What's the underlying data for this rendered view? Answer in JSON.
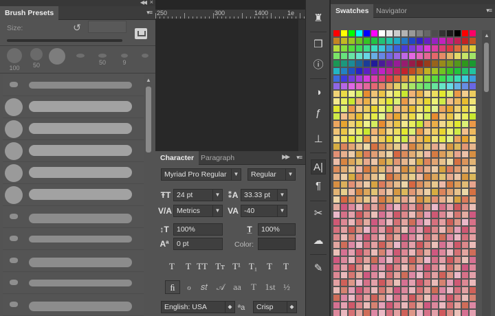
{
  "brush_panel": {
    "tab_label": "Brush Presets",
    "size_label": "Size:",
    "tip_sizes": [
      "100",
      "50",
      "",
      "",
      "50",
      "9",
      ""
    ]
  },
  "ruler": {
    "labels": [
      "250",
      "300",
      "1400",
      "1e"
    ]
  },
  "character_panel": {
    "tabs": [
      "Character",
      "Paragraph"
    ],
    "font_family": "Myriad Pro Regular",
    "font_style": "Regular",
    "font_size": "24 pt",
    "leading": "33.33 pt",
    "kerning": "Metrics",
    "tracking": "-40",
    "vertical_scale": "100%",
    "horizontal_scale": "100%",
    "baseline_shift": "0 pt",
    "color_label": "Color:",
    "style_buttons": [
      "T",
      "T",
      "TT",
      "Tт",
      "T¹",
      "T₁",
      "T",
      "T"
    ],
    "feature_buttons": [
      "ﬁ",
      "ℴ",
      "𝑠𝑡",
      "𝒜",
      "aa",
      "T",
      "1st",
      "½"
    ],
    "language": "English: USA",
    "antialias_icon": "ªa",
    "antialias": "Crisp"
  },
  "tools": [
    "history-icon",
    "3d-cube-icon",
    "info-icon",
    "adjust-icon",
    "fx-icon",
    "stamp-icon",
    "character-panel-icon",
    "paragraph-icon",
    "tools-icon",
    "creative-cloud-icon",
    "brush-tool-icon"
  ],
  "swatches_panel": {
    "tabs": [
      "Swatches",
      "Navigator"
    ],
    "top_row": [
      "#ff0000",
      "#ffff00",
      "#00ff00",
      "#00ffff",
      "#0000ff",
      "#ff00ff",
      "#ffffff",
      "#e6e6e6",
      "#cccccc",
      "#b3b3b3",
      "#999999",
      "#808080",
      "#666666",
      "#4d4d4d",
      "#333333",
      "#1a1a1a",
      "#000000",
      "#ff0000",
      "#ff0066"
    ]
  }
}
